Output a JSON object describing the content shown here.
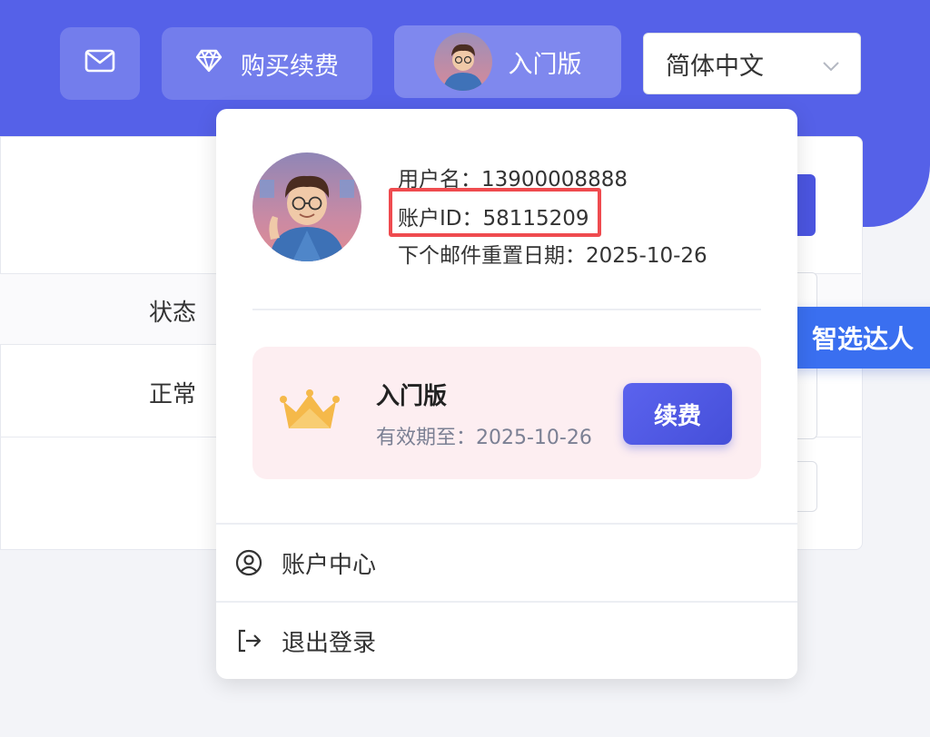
{
  "header": {
    "mail_icon": "mail-icon",
    "buy_button": {
      "icon": "diamond-icon",
      "label": "购买续费"
    },
    "plan_button": {
      "label": "入门版"
    },
    "language_select": {
      "value": "简体中文",
      "icon": "chevron-down-icon"
    }
  },
  "table": {
    "header_status": "状态",
    "row_status": "正常"
  },
  "floating_badge": {
    "label": "智选达人",
    "icon": "z-logo-icon"
  },
  "user_menu": {
    "username_line": "用户名：13900008888",
    "account_id_line": "账户ID：58115209",
    "mail_reset_line": "下个邮件重置日期：2025-10-26",
    "plan": {
      "icon": "crown-icon",
      "name": "入门版",
      "expiry": "有效期至：2025-10-26",
      "renew_label": "续费"
    },
    "items": [
      {
        "label": "账户中心",
        "icon": "user-circle-icon"
      },
      {
        "label": "退出登录",
        "icon": "logout-icon"
      }
    ]
  },
  "colors": {
    "brand": "#5561e8",
    "highlight": "#ef4b4f",
    "plan_card_bg": "#fdeef1",
    "crown": "#f5b94a",
    "badge": "#3a6ff0"
  }
}
